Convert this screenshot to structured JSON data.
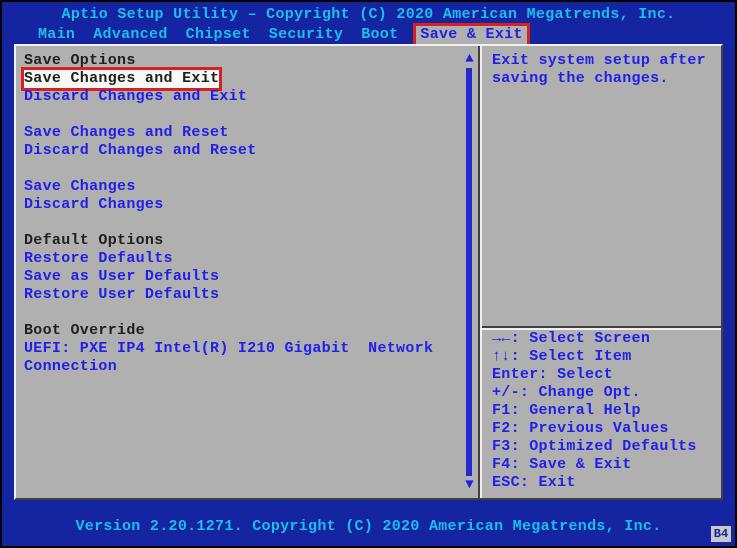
{
  "header": "Aptio Setup Utility – Copyright (C) 2020 American Megatrends, Inc.",
  "tabs": [
    "Main",
    "Advanced",
    "Chipset",
    "Security",
    "Boot",
    "Save & Exit"
  ],
  "active_tab": 5,
  "left": {
    "section1_title": "Save Options",
    "items1": [
      "Save Changes and Exit",
      "Discard Changes and Exit"
    ],
    "items2": [
      "Save Changes and Reset",
      "Discard Changes and Reset"
    ],
    "items3": [
      "Save Changes",
      "Discard Changes"
    ],
    "section2_title": "Default Options",
    "items4": [
      "Restore Defaults",
      "Save as User Defaults",
      "Restore User Defaults"
    ],
    "section3_title": "Boot Override",
    "items5_l1": "UEFI: PXE IP4 Intel(R) I210 Gigabit  Network",
    "items5_l2": "Connection",
    "selected_index": 0
  },
  "right": {
    "help": "Exit system setup after\nsaving the changes.",
    "legend": [
      "><: Select Screen",
      "^v: Select Item",
      "Enter: Select",
      "+/-: Change Opt.",
      "F1: General Help",
      "F2: Previous Values",
      "F3: Optimized Defaults",
      "F4: Save & Exit",
      "ESC: Exit"
    ],
    "legend_glyphs": {
      "screen": "→←",
      "item": "↑↓"
    }
  },
  "footer": "Version 2.20.1271. Copyright (C) 2020 American Megatrends, Inc.",
  "corner": "B4"
}
